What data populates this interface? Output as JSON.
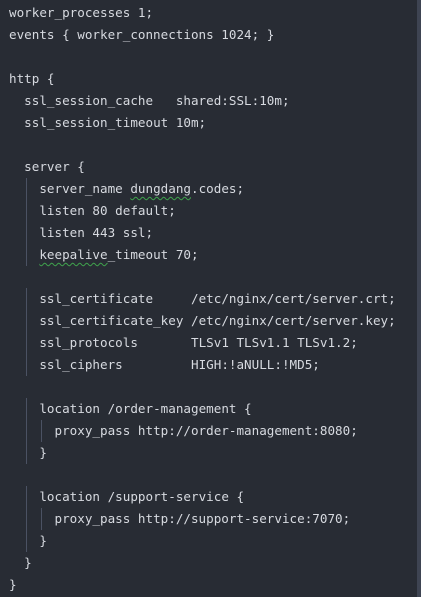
{
  "editor": {
    "lines": [
      {
        "indent": 0,
        "text": "worker_processes 1;"
      },
      {
        "indent": 0,
        "text": "events { worker_connections 1024; }"
      },
      {
        "indent": 0,
        "text": ""
      },
      {
        "indent": 0,
        "text": "http {"
      },
      {
        "indent": 1,
        "text": "ssl_session_cache   shared:SSL:10m;"
      },
      {
        "indent": 1,
        "text": "ssl_session_timeout 10m;"
      },
      {
        "indent": 0,
        "text": ""
      },
      {
        "indent": 1,
        "text": "server {"
      },
      {
        "indent": 2,
        "text": "server_name ",
        "squiggle": "dungdang",
        "after": ".codes;"
      },
      {
        "indent": 2,
        "text": "listen 80 default;"
      },
      {
        "indent": 2,
        "text": "listen 443 ssl;"
      },
      {
        "indent": 2,
        "text": "",
        "squiggle": "keepalive",
        "after": "_timeout 70;"
      },
      {
        "indent": 0,
        "text": ""
      },
      {
        "indent": 2,
        "text": "ssl_certificate     /etc/nginx/cert/server.crt;"
      },
      {
        "indent": 2,
        "text": "ssl_certificate_key /etc/nginx/cert/server.key;"
      },
      {
        "indent": 2,
        "text": "ssl_protocols       TLSv1 TLSv1.1 TLSv1.2;"
      },
      {
        "indent": 2,
        "text": "ssl_ciphers         HIGH:!aNULL:!MD5;"
      },
      {
        "indent": 0,
        "text": ""
      },
      {
        "indent": 2,
        "text": "location /order-management {"
      },
      {
        "indent": 3,
        "text": "proxy_pass http://order-management:8080;"
      },
      {
        "indent": 2,
        "text": "}"
      },
      {
        "indent": 0,
        "text": ""
      },
      {
        "indent": 2,
        "text": "location /support-service {"
      },
      {
        "indent": 3,
        "text": "proxy_pass http://support-service:7070;"
      },
      {
        "indent": 2,
        "text": "}"
      },
      {
        "indent": 1,
        "text": "}"
      },
      {
        "indent": 0,
        "text": "}"
      }
    ],
    "colors": {
      "background": "#282c34",
      "text": "#d7dae0",
      "indent_guide": "#4b5263",
      "spell_squiggle": "#3fa34d"
    }
  }
}
